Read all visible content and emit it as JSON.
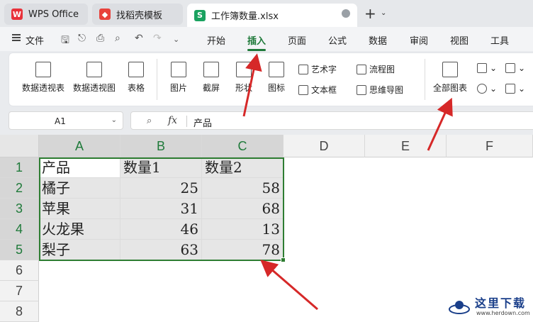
{
  "tabs": [
    {
      "label": "WPS Office"
    },
    {
      "label": "找稻壳模板"
    },
    {
      "label": "工作簿数量.xlsx"
    }
  ],
  "menu": {
    "file": "文件",
    "tabs": [
      "开始",
      "插入",
      "页面",
      "公式",
      "数据",
      "审阅",
      "视图",
      "工具"
    ]
  },
  "ribbon": {
    "pivot_table": "数据透视表",
    "pivot_view": "数据透视图",
    "table": "表格",
    "picture": "图片",
    "screenshot": "截屏",
    "shape": "形状",
    "icon": "图标",
    "wordart": "艺术字",
    "textbox": "文本框",
    "flowchart": "流程图",
    "mindmap": "思维导图",
    "all_charts": "全部图表"
  },
  "formula_bar": {
    "name_box": "A1",
    "fx": "fx",
    "value": "产品"
  },
  "sheet": {
    "columns": [
      "A",
      "B",
      "C",
      "D",
      "E",
      "F"
    ],
    "rows": [
      "1",
      "2",
      "3",
      "4",
      "5",
      "6",
      "7",
      "8"
    ],
    "data": [
      [
        "产品",
        "数量1",
        "数量2"
      ],
      [
        "橘子",
        "25",
        "58"
      ],
      [
        "苹果",
        "31",
        "68"
      ],
      [
        "火龙果",
        "46",
        "13"
      ],
      [
        "梨子",
        "63",
        "78"
      ]
    ]
  },
  "watermark": {
    "text": "这里下载",
    "sub": "www.herdown.com"
  },
  "colors": {
    "accent": "#1f7a3a",
    "selection": "#2e7d32",
    "arrow": "#d62828"
  }
}
